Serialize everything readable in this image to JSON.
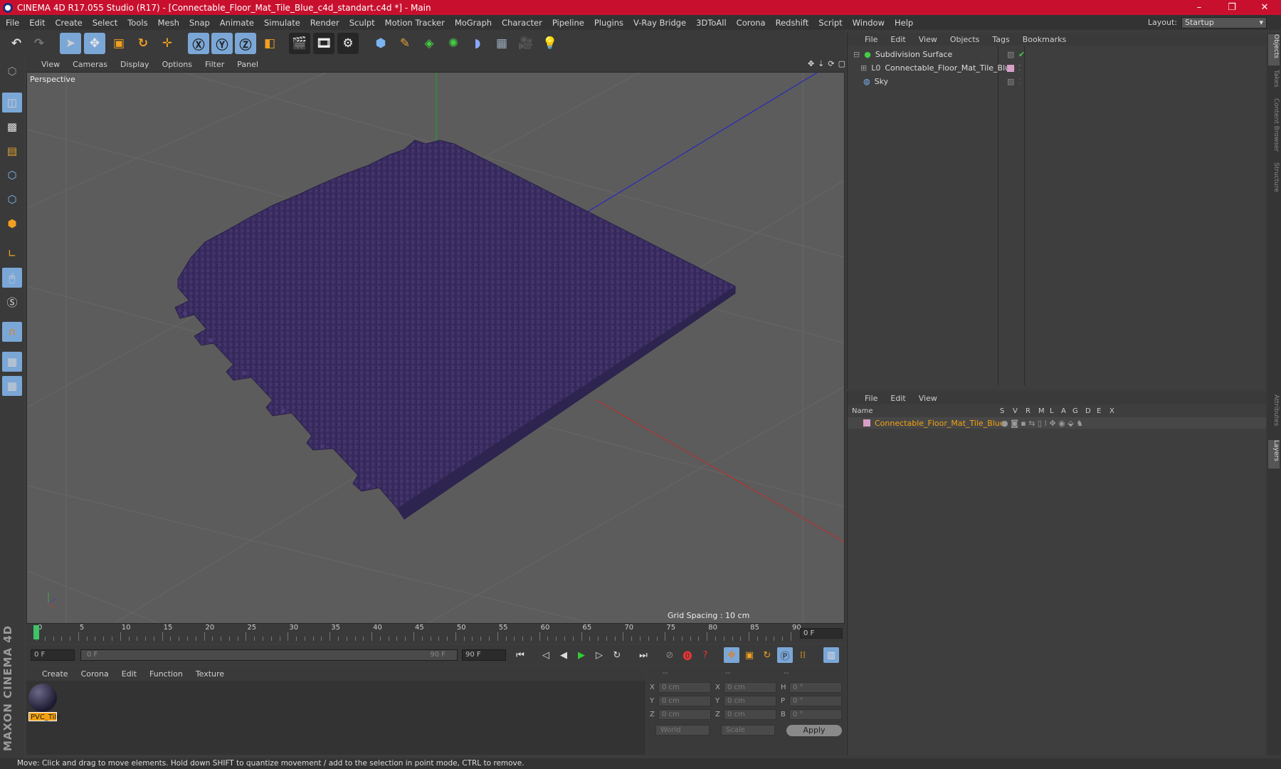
{
  "window": {
    "title": "CINEMA 4D R17.055 Studio (R17) - [Connectable_Floor_Mat_Tile_Blue_c4d_standart.c4d *] - Main",
    "controls": [
      "–",
      "❐",
      "✕"
    ]
  },
  "menubar": {
    "items": [
      "File",
      "Edit",
      "Create",
      "Select",
      "Tools",
      "Mesh",
      "Snap",
      "Animate",
      "Simulate",
      "Render",
      "Sculpt",
      "Motion Tracker",
      "MoGraph",
      "Character",
      "Pipeline",
      "Plugins",
      "V-Ray Bridge",
      "3DToAll",
      "Corona",
      "Redshift",
      "Script",
      "Window",
      "Help"
    ],
    "layout_label": "Layout:",
    "layout_value": "Startup"
  },
  "viewport": {
    "menu": [
      "View",
      "Cameras",
      "Display",
      "Options",
      "Filter",
      "Panel"
    ],
    "camera_label": "Perspective",
    "grid_spacing": "Grid Spacing : 10 cm"
  },
  "timeline": {
    "ticks": [
      "0",
      "5",
      "10",
      "15",
      "20",
      "25",
      "30",
      "35",
      "40",
      "45",
      "50",
      "55",
      "60",
      "65",
      "70",
      "75",
      "80",
      "85",
      "90"
    ],
    "current_frame": "0 F",
    "start_field": "0 F",
    "range_start": "0 F",
    "range_end": "90 F",
    "end_field": "90 F"
  },
  "material_manager": {
    "menu": [
      "Create",
      "Corona",
      "Edit",
      "Function",
      "Texture"
    ],
    "materials": [
      {
        "name": "PVC_Tile"
      }
    ]
  },
  "coordinates": {
    "headers": [
      "--",
      "--",
      "--"
    ],
    "rows": [
      {
        "a": "X",
        "av": "0 cm",
        "b": "X",
        "bv": "0 cm",
        "c": "H",
        "cv": "0 °"
      },
      {
        "a": "Y",
        "av": "0 cm",
        "b": "Y",
        "bv": "0 cm",
        "c": "P",
        "cv": "0 °"
      },
      {
        "a": "Z",
        "av": "0 cm",
        "b": "Z",
        "bv": "0 cm",
        "c": "B",
        "cv": "0 °"
      }
    ],
    "mode": "World",
    "transform": "Scale",
    "apply": "Apply"
  },
  "object_manager": {
    "menu": [
      "File",
      "Edit",
      "View",
      "Objects",
      "Tags",
      "Bookmarks"
    ],
    "objects": [
      {
        "name": "Subdivision Surface"
      },
      {
        "name": "Connectable_Floor_Mat_Tile_Blue"
      },
      {
        "name": "Sky"
      }
    ]
  },
  "layer_manager": {
    "menu": [
      "File",
      "Edit",
      "View"
    ],
    "columns": [
      "Name",
      "S",
      "V",
      "R",
      "M",
      "L",
      "A",
      "G",
      "D",
      "E",
      "X"
    ],
    "layers": [
      {
        "name": "Connectable_Floor_Mat_Tile_Blue"
      }
    ]
  },
  "right_tabs": [
    "Objects",
    "Takes",
    "Content Browser",
    "Structure",
    "Attributes",
    "Layers"
  ],
  "branding": "MAXON CINEMA 4D",
  "status": "Move: Click and drag to move elements. Hold down SHIFT to quantize movement / add to the selection in point mode, CTRL to remove.",
  "colors": {
    "accent": "#7ba7d7",
    "title_red": "#c8102e",
    "mat_purple": "#3b2d5e",
    "highlight": "#f3a10f"
  }
}
